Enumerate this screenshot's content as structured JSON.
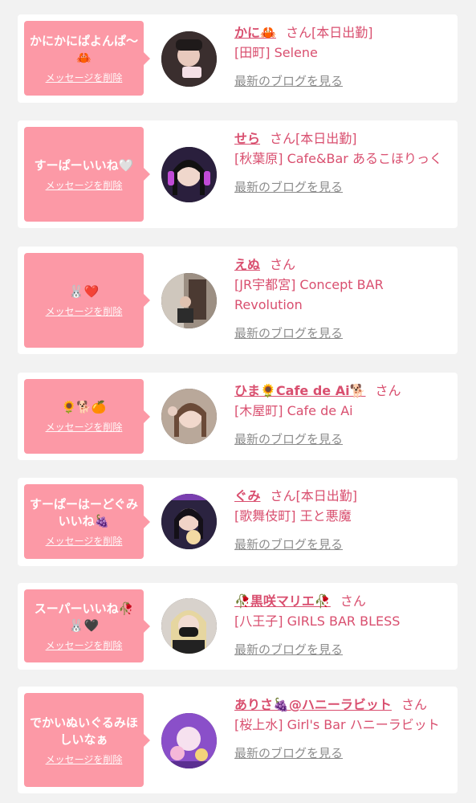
{
  "delete_label": "メッセージを削除",
  "san_label": "さん",
  "blog_label": "最新のブログを見る",
  "colors": {
    "bubble": "#fc99a6",
    "accent": "#d94f6f",
    "muted": "#8c8c8c",
    "bg": "#f2f2f2"
  },
  "cards": [
    {
      "message": "かにかにぱよんぱ〜🦀",
      "name": "かに🦀",
      "status": "[本日出勤]",
      "shop": "[田町] Selene"
    },
    {
      "message": "すーぱーいいね🤍",
      "name": "せら",
      "status": "[本日出勤]",
      "shop": "[秋葉原] Cafe&Bar あるこほりっく"
    },
    {
      "message": "🐰❤️",
      "name": "えぬ",
      "status": "",
      "shop": "[JR宇都宮] Concept BAR Revolution"
    },
    {
      "message": "🌻🐕🍊",
      "name": "ひま🌻Cafe de Ai🐕",
      "status": "",
      "shop": "[木屋町] Cafe de Ai"
    },
    {
      "message": "すーぱーはーどぐみいいね🍇",
      "name": "ぐみ",
      "status": "[本日出勤]",
      "shop": "[歌舞伎町] 王と悪魔"
    },
    {
      "message": "スーパーいいね🥀🐰🖤",
      "name": "🥀黒咲マリエ🥀",
      "status": "",
      "shop": "[八王子] GIRLS BAR BLESS"
    },
    {
      "message": "でかいぬいぐるみほしいなぁ",
      "name": "ありさ🍇@ハニーラビット",
      "status": "",
      "shop": "[桜上水] Girl's Bar ハニーラビット"
    }
  ]
}
